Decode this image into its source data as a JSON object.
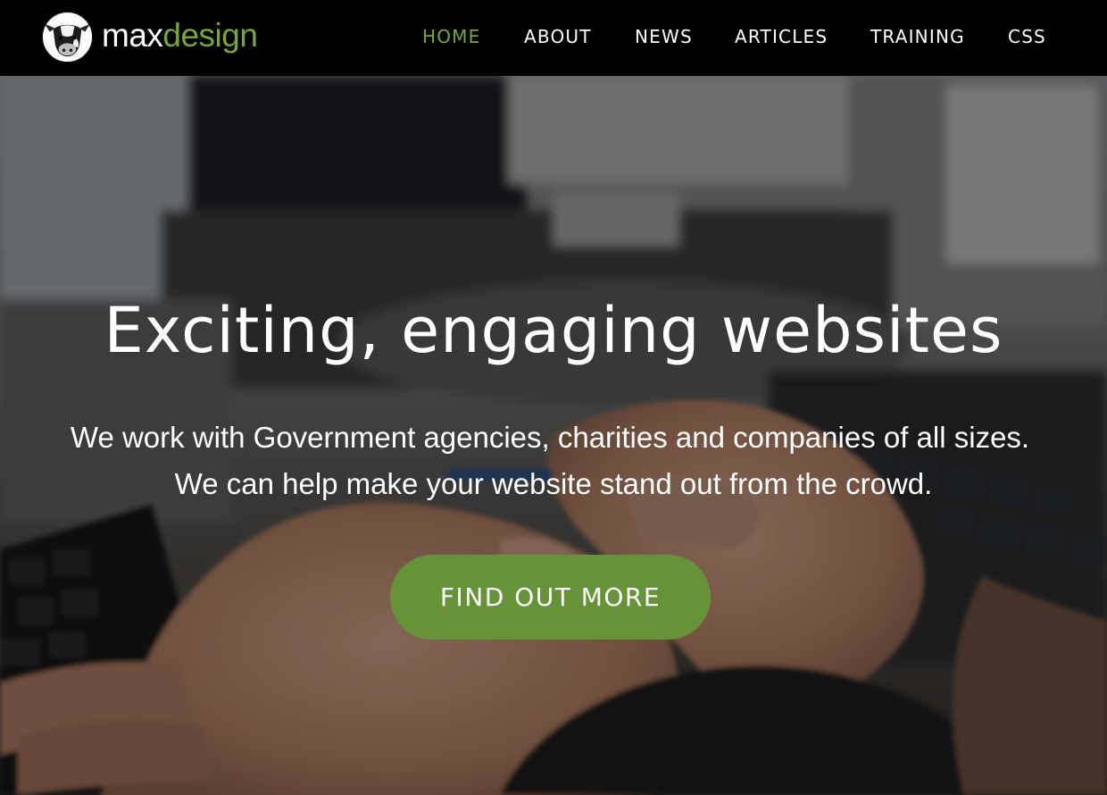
{
  "brand": {
    "name_part1": "max",
    "name_part2": "design",
    "accent_color": "#79a53a",
    "logo_icon": "cow-head-icon"
  },
  "nav": {
    "items": [
      {
        "label": "HOME",
        "active": true
      },
      {
        "label": "ABOUT",
        "active": false
      },
      {
        "label": "NEWS",
        "active": false
      },
      {
        "label": "ARTICLES",
        "active": false
      },
      {
        "label": "TRAINING",
        "active": false
      },
      {
        "label": "CSS",
        "active": false
      }
    ]
  },
  "hero": {
    "headline": "Exciting, engaging websites",
    "sub_line_1": "We work with Government agencies, charities and companies of all sizes.",
    "sub_line_2": "We can help make your website stand out from the crowd.",
    "cta_label": "FIND OUT MORE",
    "cta_color": "#66923a"
  }
}
